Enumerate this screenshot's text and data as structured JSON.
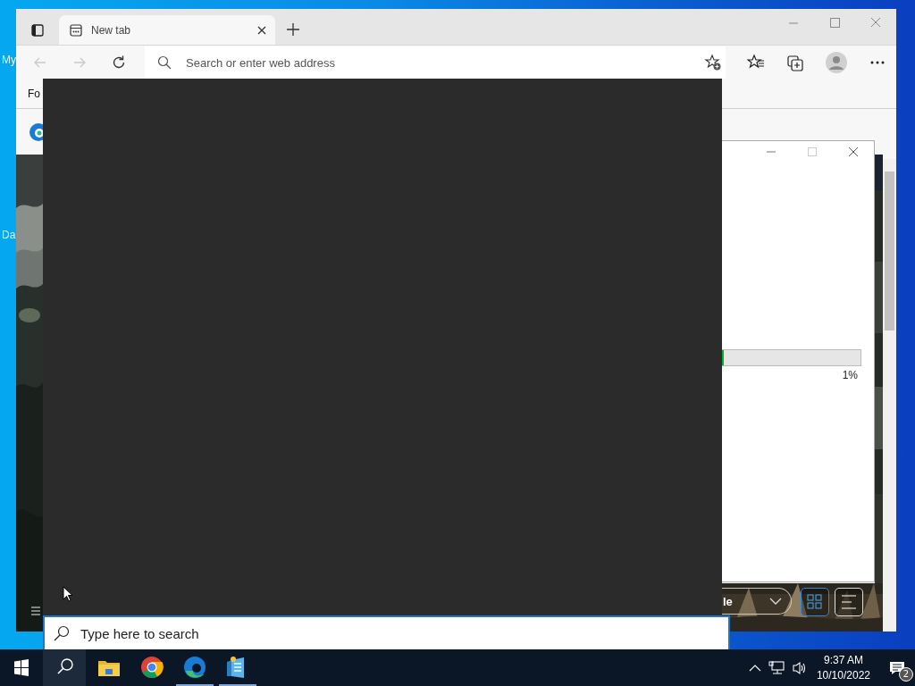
{
  "desktop": {
    "icon_labels": [
      "My",
      "Da"
    ]
  },
  "browser": {
    "tabs": [
      {
        "label": "New tab",
        "selected": true
      }
    ],
    "nav": [
      {
        "kind": "back",
        "disabled": true
      },
      {
        "kind": "forward",
        "disabled": true
      },
      {
        "kind": "refresh",
        "disabled": false
      }
    ],
    "address_bar": {
      "placeholder": "Search or enter web address"
    },
    "favorites_bar": {
      "items": [
        "Fo"
      ]
    },
    "page": {
      "dropdown": {
        "value": "le"
      },
      "view_buttons": [
        {
          "kind": "grid",
          "selected": true
        },
        {
          "kind": "list",
          "selected": false
        }
      ]
    }
  },
  "dialog": {
    "progress": {
      "level": 0.01
    },
    "reading": "1%"
  },
  "search_box": {
    "placeholder": "Type here to search"
  },
  "taskbar": {
    "apps": [
      {
        "kind": "explorer",
        "running": false
      },
      {
        "kind": "chrome",
        "running": false
      },
      {
        "kind": "edge",
        "running": true
      },
      {
        "kind": "app",
        "running": true
      }
    ],
    "clock": {
      "time": "9:37 AM",
      "date": "10/10/2022"
    },
    "notifications": {
      "count": "2"
    }
  }
}
